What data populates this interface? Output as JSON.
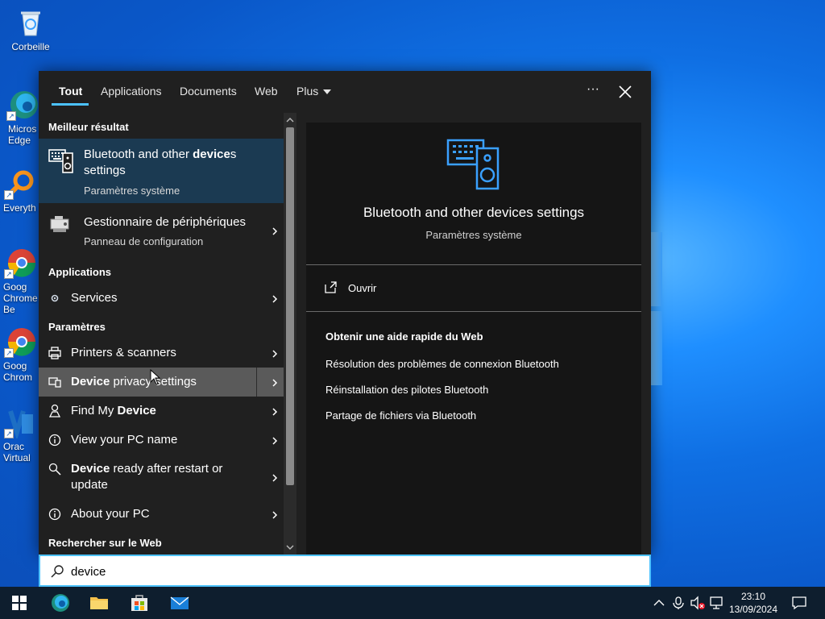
{
  "desktop": {
    "icons": [
      {
        "label": "Corbeille"
      },
      {
        "label": "Micros Edge"
      },
      {
        "label": "Everyth"
      },
      {
        "label": "Goog Chrome Be"
      },
      {
        "label": "Goog Chrom"
      },
      {
        "label": "Orac Virtual"
      }
    ]
  },
  "search": {
    "tabs": [
      "Tout",
      "Applications",
      "Documents",
      "Web",
      "Plus"
    ],
    "active_tab": "Tout",
    "more_label": "···",
    "query": "device",
    "sections": {
      "best_match": "Meilleur résultat",
      "apps": "Applications",
      "settings": "Paramètres",
      "web": "Rechercher sur le Web"
    },
    "best_match": {
      "title_before": "Bluetooth and other ",
      "title_bold": "device",
      "title_after": "s settings",
      "title_line2": "",
      "subtitle": "Paramètres système"
    },
    "second": {
      "title": "Gestionnaire de périphériques",
      "subtitle": "Panneau de configuration"
    },
    "apps": [
      {
        "title": "Services"
      }
    ],
    "settings": [
      {
        "title": "Printers & scanners"
      },
      {
        "bold": "Device",
        "rest": " privacy settings"
      },
      {
        "pre": "Find My ",
        "bold": "Device"
      },
      {
        "title": "View your PC name"
      },
      {
        "bold": "Device",
        "rest": " ready after restart or",
        "line2": "update"
      },
      {
        "title": "About your PC"
      }
    ],
    "preview": {
      "title": "Bluetooth and other devices settings",
      "subtitle": "Paramètres système",
      "open": "Ouvrir",
      "web_header": "Obtenir une aide rapide du Web",
      "web_links": [
        "Résolution des problèmes de connexion Bluetooth",
        "Réinstallation des pilotes Bluetooth",
        "Partage de fichiers via Bluetooth"
      ]
    }
  },
  "taskbar": {
    "time": "23:10",
    "date": "13/09/2024"
  },
  "colors": {
    "accent": "#4cc2ff",
    "best_bg": "#1b3a52",
    "hover_bg": "#5a5a5a",
    "icon_blue": "#3aa0ff"
  }
}
